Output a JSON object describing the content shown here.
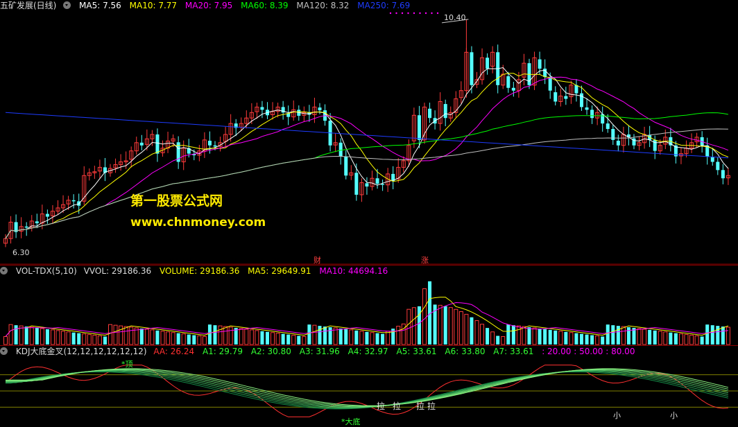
{
  "main": {
    "title": "五矿发展(日线)",
    "ma": [
      {
        "label": "MA5: 7.56",
        "color": "#ffffff"
      },
      {
        "label": "MA10: 7.77",
        "color": "#ffff00"
      },
      {
        "label": "MA20: 7.95",
        "color": "#ff00ff"
      },
      {
        "label": "MA60: 8.39",
        "color": "#00ff00"
      },
      {
        "label": "MA120: 8.32",
        "color": "#c0c0c0"
      },
      {
        "label": "MA250: 7.69",
        "color": "#1e3cff"
      }
    ],
    "high_label": "10.40",
    "low_label": "6.30",
    "event_marks": [
      "财",
      "涨"
    ],
    "watermark_cn": "第一股票公式网",
    "watermark_url": "www.chnmoney.com",
    "candles": [
      6.4,
      6.7,
      6.52,
      6.62,
      6.6,
      6.72,
      6.68,
      6.85,
      6.8,
      6.9,
      6.96,
      7.02,
      7.1,
      7.08,
      7.0,
      7.55,
      7.6,
      7.62,
      7.7,
      7.6,
      7.68,
      7.75,
      7.8,
      7.82,
      8.0,
      8.15,
      8.1,
      8.22,
      8.3,
      7.95,
      8.05,
      8.18,
      8.22,
      7.8,
      8.05,
      7.95,
      7.92,
      8.0,
      8.2,
      8.1,
      8.08,
      8.15,
      8.3,
      8.5,
      8.42,
      8.5,
      8.6,
      8.7,
      8.8,
      8.75,
      8.65,
      8.72,
      8.8,
      8.7,
      8.62,
      8.75,
      8.64,
      8.7,
      8.66,
      8.8,
      8.74,
      8.55,
      8.1,
      8.15,
      7.9,
      7.55,
      7.6,
      7.2,
      7.42,
      7.35,
      7.5,
      7.4,
      7.38,
      7.58,
      7.45,
      7.7,
      7.82,
      8.1,
      8.65,
      8.2,
      8.8,
      8.6,
      8.5,
      8.9,
      8.6,
      8.7,
      8.95,
      9.1,
      9.8,
      9.2,
      9.3,
      9.7,
      9.5,
      9.8,
      9.2,
      9.4,
      9.15,
      9.1,
      9.3,
      9.6,
      9.2,
      9.7,
      9.5,
      9.35,
      9.1,
      8.9,
      9.0,
      8.95,
      9.2,
      9.05,
      8.8,
      8.75,
      8.6,
      8.7,
      8.5,
      8.4,
      8.2,
      8.1,
      8.3,
      8.25,
      8.1,
      8.15,
      8.3,
      8.2,
      8.0,
      8.1,
      8.25,
      8.1,
      7.9,
      7.95,
      8.05,
      8.15,
      8.25,
      8.1,
      7.9,
      7.8,
      7.65,
      7.5,
      7.55
    ]
  },
  "vol": {
    "title": "VOL-TDX(5,10)",
    "items": [
      {
        "label": "VVOL: 29186.36",
        "color": "#dddddd"
      },
      {
        "label": "VOLUME: 29186.36",
        "color": "#ffff00"
      },
      {
        "label": "MA5: 29649.91",
        "color": "#ffff00"
      },
      {
        "label": "MA10: 44694.16",
        "color": "#ff00ff"
      }
    ]
  },
  "kdj": {
    "title": "KDJ大底金叉(12,12,12,12,12,12)",
    "items": [
      {
        "label": "AA: 26.24",
        "color": "#ff3030"
      },
      {
        "label": "A1: 29.79",
        "color": "#33ff33"
      },
      {
        "label": "A2: 30.80",
        "color": "#33ff33"
      },
      {
        "label": "A3: 31.96",
        "color": "#33ff33"
      },
      {
        "label": "A4: 32.97",
        "color": "#33ff33"
      },
      {
        "label": "A5: 33.61",
        "color": "#33ff33"
      },
      {
        "label": "A6: 33.80",
        "color": "#33ff33"
      },
      {
        "label": "A7: 33.61",
        "color": "#33ff33"
      }
    ],
    "levels": ": 20.00 : 50.00 : 80.00",
    "signals": {
      "top": "*顶",
      "bottom": "*大底",
      "la": [
        "拉",
        "拉",
        "拉",
        "拉"
      ],
      "small": [
        "小",
        "小"
      ]
    }
  }
}
